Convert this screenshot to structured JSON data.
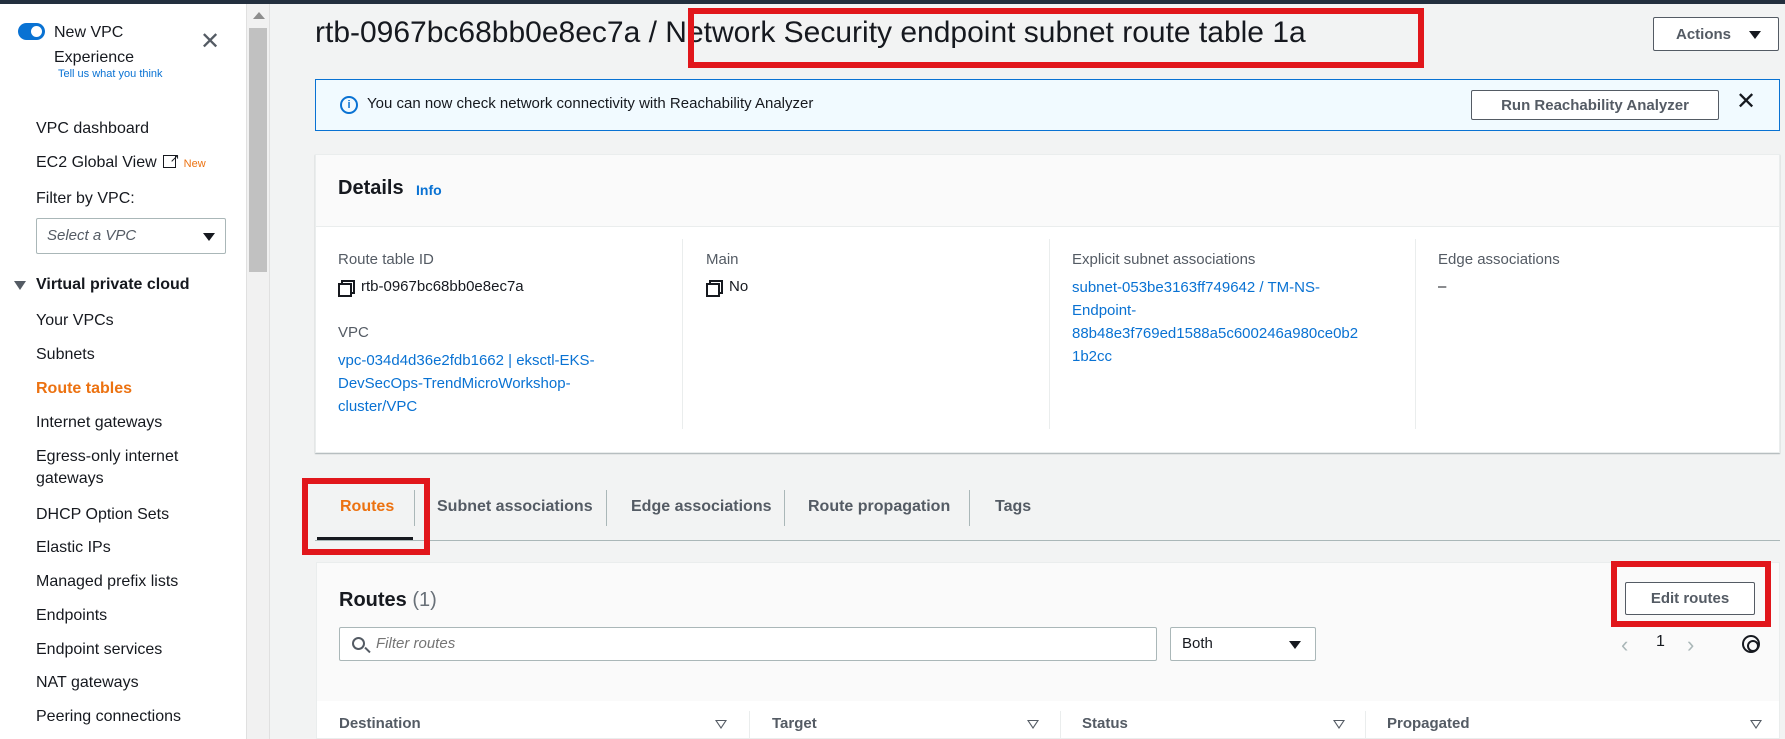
{
  "sidebar": {
    "toggle_label": "New VPC Experience",
    "tell_us": "Tell us what you think",
    "dashboard": "VPC dashboard",
    "ec2_global": "EC2 Global View",
    "new_badge": "New",
    "filter_label": "Filter by VPC:",
    "vpc_select_placeholder": "Select a VPC",
    "section_title": "Virtual private cloud",
    "items": [
      "Your VPCs",
      "Subnets",
      "Route tables",
      "Internet gateways",
      "Egress-only internet gateways",
      "DHCP Option Sets",
      "Elastic IPs",
      "Managed prefix lists",
      "Endpoints",
      "Endpoint services",
      "NAT gateways",
      "Peering connections"
    ],
    "active_item": "Route tables"
  },
  "page": {
    "title_id": "rtb-0967bc68bb0e8ec7a /",
    "title_name": "Network Security endpoint subnet route table 1a",
    "actions_label": "Actions"
  },
  "flash": {
    "message": "You can now check network connectivity with Reachability Analyzer",
    "button": "Run Reachability Analyzer"
  },
  "details": {
    "title": "Details",
    "info": "Info",
    "route_table_id_label": "Route table ID",
    "route_table_id": "rtb-0967bc68bb0e8ec7a",
    "vpc_label": "VPC",
    "vpc_line1": "vpc-034d4d36e2fdb1662 | eksctl-EKS-",
    "vpc_line2": "DevSecOps-TrendMicroWorkshop-",
    "vpc_line3": "cluster/VPC",
    "main_label": "Main",
    "main_value": "No",
    "explicit_label": "Explicit subnet associations",
    "explicit_line1": "subnet-053be3163ff749642 / TM-NS-",
    "explicit_line2": "Endpoint-",
    "explicit_line3": "88b48e3f769ed1588a5c600246a980ce0b2",
    "explicit_line4": "1b2cc",
    "edge_label": "Edge associations",
    "edge_value": "–"
  },
  "tabs": [
    "Routes",
    "Subnet associations",
    "Edge associations",
    "Route propagation",
    "Tags"
  ],
  "routes": {
    "title": "Routes",
    "count": "(1)",
    "edit_button": "Edit routes",
    "filter_placeholder": "Filter routes",
    "select_value": "Both",
    "page": "1",
    "columns": [
      "Destination",
      "Target",
      "Status",
      "Propagated"
    ]
  },
  "colors": {
    "accent": "#0972d3",
    "active": "#ec7211",
    "highlight": "#e1161b"
  }
}
